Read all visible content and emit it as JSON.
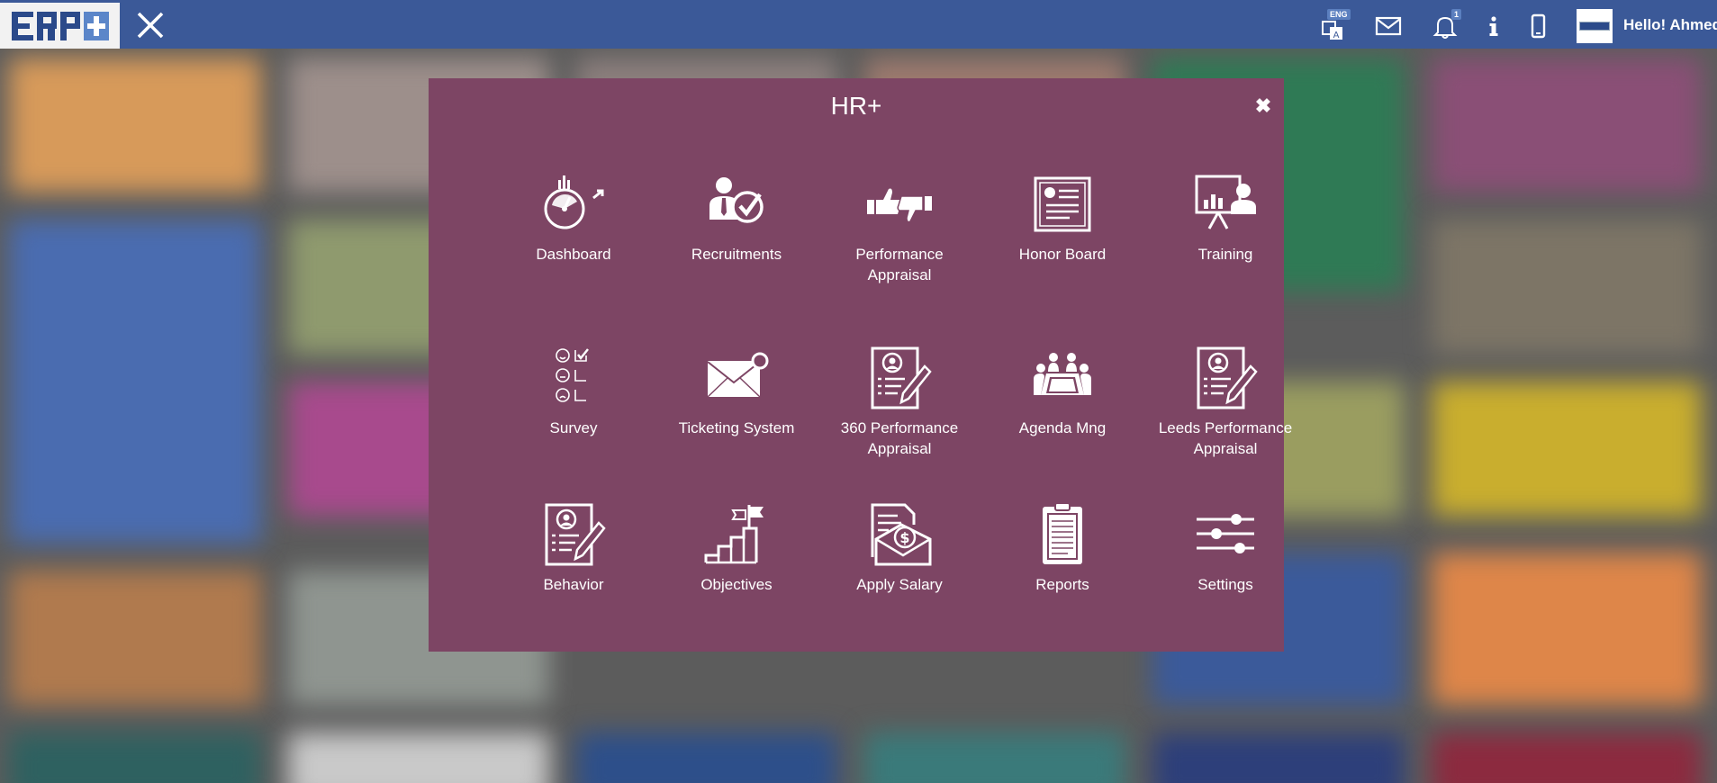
{
  "topbar": {
    "logo_text": "ERP+",
    "language_badge": "ENG",
    "notification_count": "1",
    "greeting": "Hello! Ahmed"
  },
  "modal": {
    "title": "HR+",
    "close_symbol": "✖",
    "apps": [
      {
        "label": "Dashboard",
        "icon": "speedometer-icon"
      },
      {
        "label": "Recruitments",
        "icon": "recruit-check-icon"
      },
      {
        "label": "Performance Appraisal",
        "icon": "thumbs-icon"
      },
      {
        "label": "Honor Board",
        "icon": "certificate-icon"
      },
      {
        "label": "Training",
        "icon": "presentation-board-icon"
      },
      {
        "label": "Survey",
        "icon": "survey-checklist-icon"
      },
      {
        "label": "Ticketing System",
        "icon": "envelope-icon"
      },
      {
        "label": "360 Performance Appraisal",
        "icon": "profile-document-icon"
      },
      {
        "label": "Agenda Mng",
        "icon": "meeting-table-icon"
      },
      {
        "label": "Leeds Performance Appraisal",
        "icon": "profile-document-icon"
      },
      {
        "label": "Behavior",
        "icon": "profile-document-icon"
      },
      {
        "label": "Objectives",
        "icon": "stairs-flag-icon"
      },
      {
        "label": "Apply Salary",
        "icon": "salary-envelope-icon"
      },
      {
        "label": "Reports",
        "icon": "clipboard-icon"
      },
      {
        "label": "Settings",
        "icon": "sliders-icon"
      }
    ]
  },
  "colors": {
    "topbar": "#3b5998",
    "modal": "#7d4564"
  }
}
